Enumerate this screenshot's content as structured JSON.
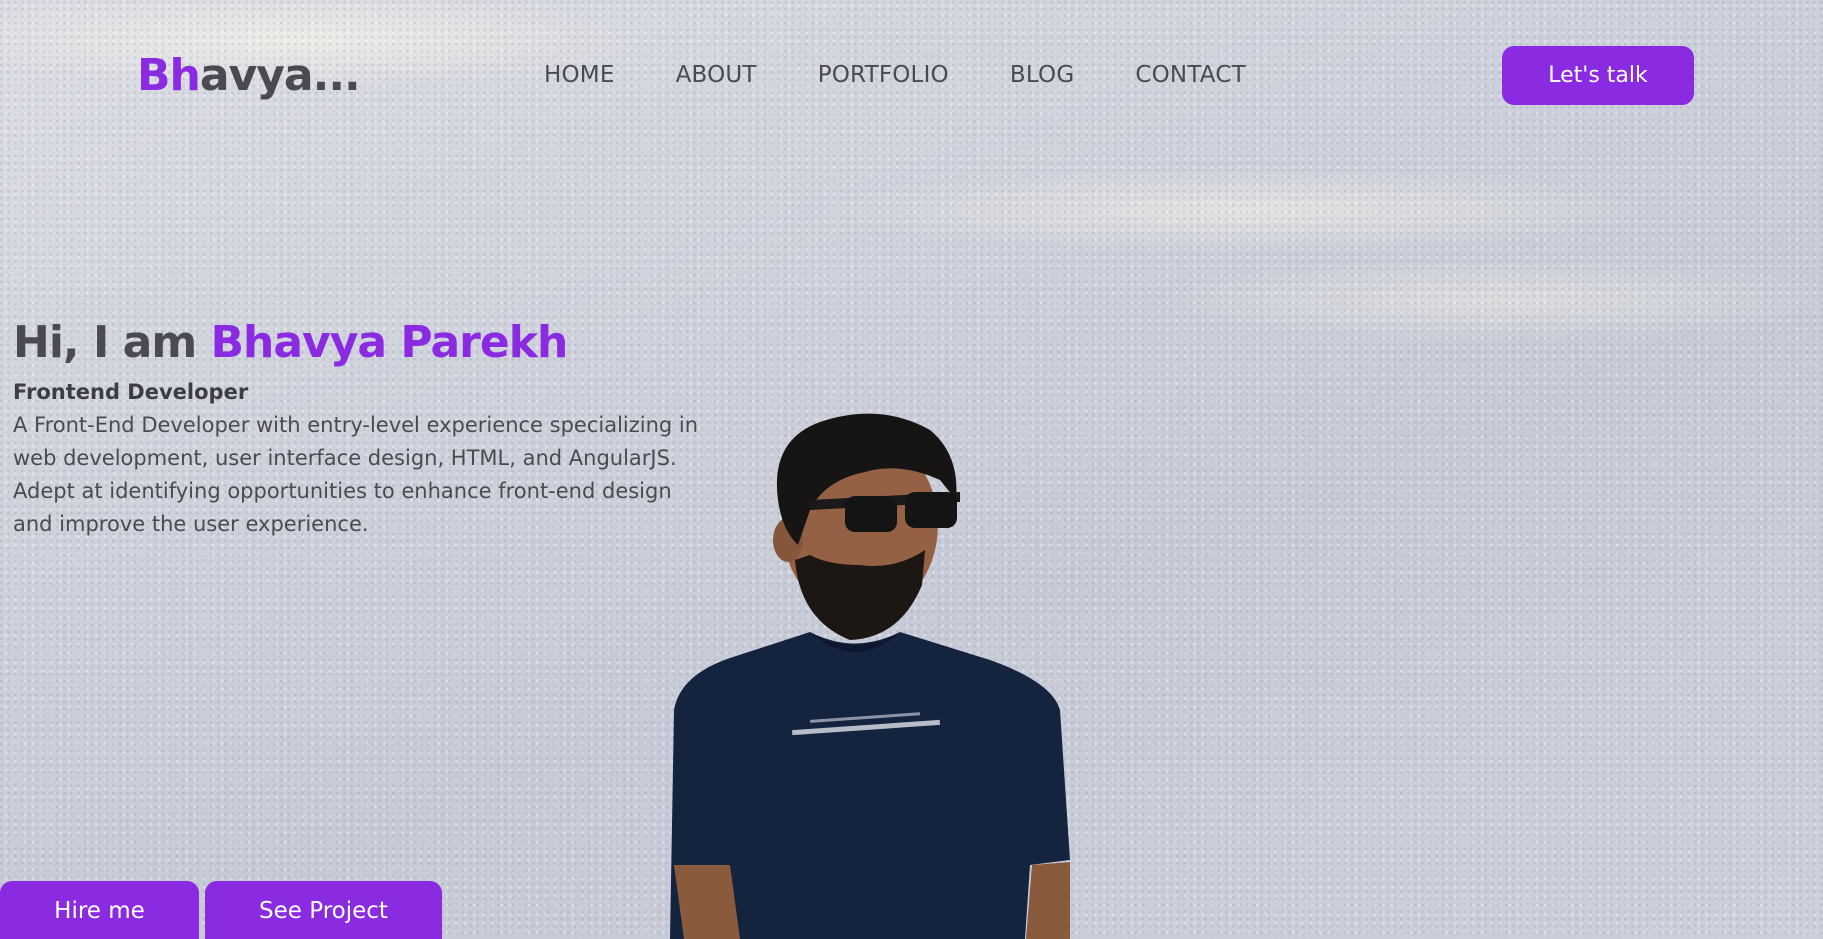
{
  "header": {
    "logo_accent": "Bh",
    "logo_rest": "avya...",
    "nav": [
      {
        "label": "HOME"
      },
      {
        "label": "ABOUT"
      },
      {
        "label": "PORTFOLIO"
      },
      {
        "label": "BLOG"
      },
      {
        "label": "CONTACT"
      }
    ],
    "cta_label": "Let's talk"
  },
  "hero": {
    "greeting": "Hi, I am ",
    "name": "Bhavya Parekh",
    "role": "Frontend Developer",
    "description": "A Front-End Developer with entry-level experience specializing in web development, user interface design, HTML, and AngularJS. Adept at identifying opportunities to enhance front-end design and improve the user experience.",
    "buttons": {
      "hire_label": "Hire me",
      "project_label": "See Project"
    }
  },
  "colors": {
    "accent": "#8a2be2",
    "text": "#4a4a52",
    "button_text": "#ffffff"
  }
}
